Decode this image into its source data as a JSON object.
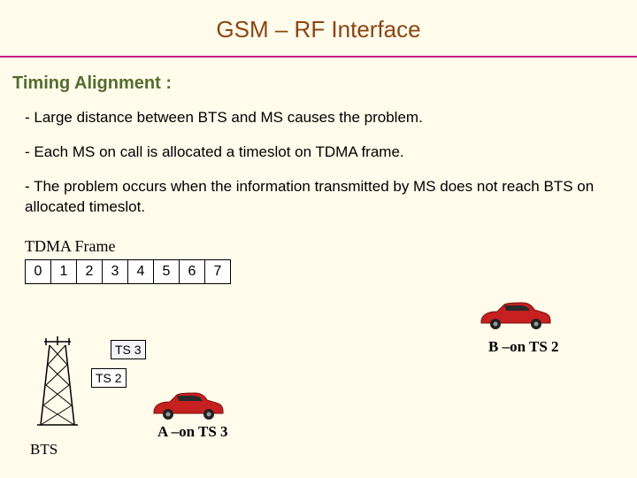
{
  "title": "GSM – RF Interface",
  "subtitle": "Timing Alignment :",
  "bullets": {
    "b0": "- Large distance between BTS and MS causes the problem.",
    "b1": "- Each MS on call is allocated a timeslot on TDMA frame.",
    "b2": "- The problem occurs when the information transmitted by MS does not reach BTS on allocated timeslot."
  },
  "frame_label": "TDMA Frame",
  "slots": {
    "s0": "0",
    "s1": "1",
    "s2": "2",
    "s3": "3",
    "s4": "4",
    "s5": "5",
    "s6": "6",
    "s7": "7"
  },
  "ts3_label": "TS 3",
  "ts2_label": "TS 2",
  "a_label": "A –on TS 3",
  "b_label": "B –on TS 2",
  "bts_label": "BTS",
  "colors": {
    "title": "#8b4513",
    "underline": "#c71585",
    "subtitle": "#556b2f",
    "car_red": "#c62020",
    "car_red_dark": "#7a1010",
    "ts3_fill": "#f4f4f8"
  }
}
